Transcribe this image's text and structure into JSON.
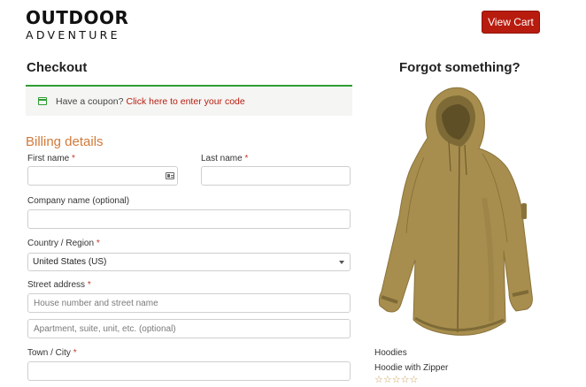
{
  "header": {
    "logo_main": "OUTDOOR",
    "logo_sub": "ADVENTURE",
    "view_cart_label": "View Cart"
  },
  "checkout": {
    "title": "Checkout",
    "coupon_text": "Have a coupon?",
    "coupon_link": "Click here to enter your code",
    "billing_title": "Billing details",
    "fields": {
      "first_name": {
        "label": "First name",
        "value": "",
        "placeholder": ""
      },
      "last_name": {
        "label": "Last name",
        "value": "",
        "placeholder": ""
      },
      "company": {
        "label": "Company name (optional)",
        "value": "",
        "placeholder": ""
      },
      "country": {
        "label": "Country / Region",
        "value": "United States (US)"
      },
      "street": {
        "label": "Street address",
        "placeholder_1": "House number and street name",
        "placeholder_2": "Apartment, suite, unit, etc. (optional)"
      },
      "city": {
        "label": "Town / City",
        "value": "",
        "placeholder": ""
      }
    },
    "required_mark": "*"
  },
  "sidebar": {
    "title": "Forgot something?",
    "product": {
      "category": "Hoodies",
      "name": "Hoodie with Zipper",
      "rating": "☆☆☆☆☆",
      "image_icon": "hoodie-image"
    }
  },
  "colors": {
    "brand_red": "#b81c0f",
    "billing_orange": "#d07a3b",
    "coupon_green": "#2f9e33",
    "hoodie_tan": "#a88e4e"
  }
}
